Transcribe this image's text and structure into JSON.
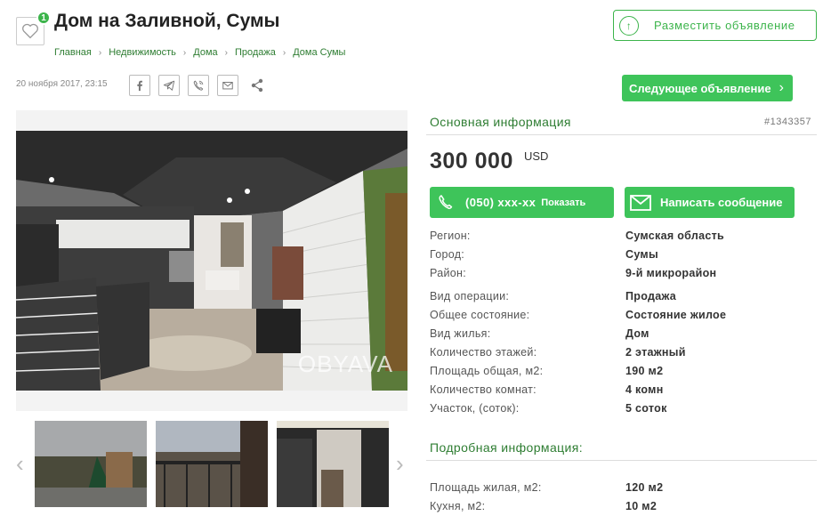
{
  "favorites": {
    "count": "1"
  },
  "title": "Дом на Заливной, Сумы",
  "breadcrumb": [
    "Главная",
    "Недвижимость",
    "Дома",
    "Продажа",
    "Дома Сумы"
  ],
  "post_button": {
    "label": "Разместить объявление",
    "icon": "arrow-up-circle-icon"
  },
  "date": "20 ноября 2017, 23:15",
  "share_icons": [
    "facebook-icon",
    "telegram-icon",
    "viber-icon",
    "email-icon",
    "share-icon"
  ],
  "next_button": {
    "label": "Следующее объявление"
  },
  "gallery": {
    "watermark": "OBYAVA"
  },
  "main_info": {
    "heading": "Основная информация",
    "ad_id": "#1343357",
    "price": "300 000",
    "currency": "USD",
    "phone_number": "(050) xxx-xx",
    "phone_show": "Показать",
    "message_label": "Написать сообщение",
    "rows": [
      {
        "k": "Регион:",
        "v": "Сумская область"
      },
      {
        "k": "Город:",
        "v": "Сумы"
      },
      {
        "k": "Район:",
        "v": "9-й микрорайон"
      },
      {
        "k": "Вид операции:",
        "v": "Продажа"
      },
      {
        "k": "Общее состояние:",
        "v": "Состояние жилое"
      },
      {
        "k": "Вид жилья:",
        "v": "Дом"
      },
      {
        "k": "Количество этажей:",
        "v": "2 этажный"
      },
      {
        "k": "Площадь общая, м2:",
        "v": "190 м2"
      },
      {
        "k": "Количество комнат:",
        "v": "4 комн"
      },
      {
        "k": "Участок, (соток):",
        "v": "5 соток"
      }
    ]
  },
  "details": {
    "heading": "Подробная информация:",
    "rows": [
      {
        "k": "Площадь жилая, м2:",
        "v": "120 м2"
      },
      {
        "k": "Кухня, м2:",
        "v": "10 м2"
      }
    ]
  },
  "colors": {
    "accent": "#3ec45a",
    "link": "#2e7d32"
  }
}
